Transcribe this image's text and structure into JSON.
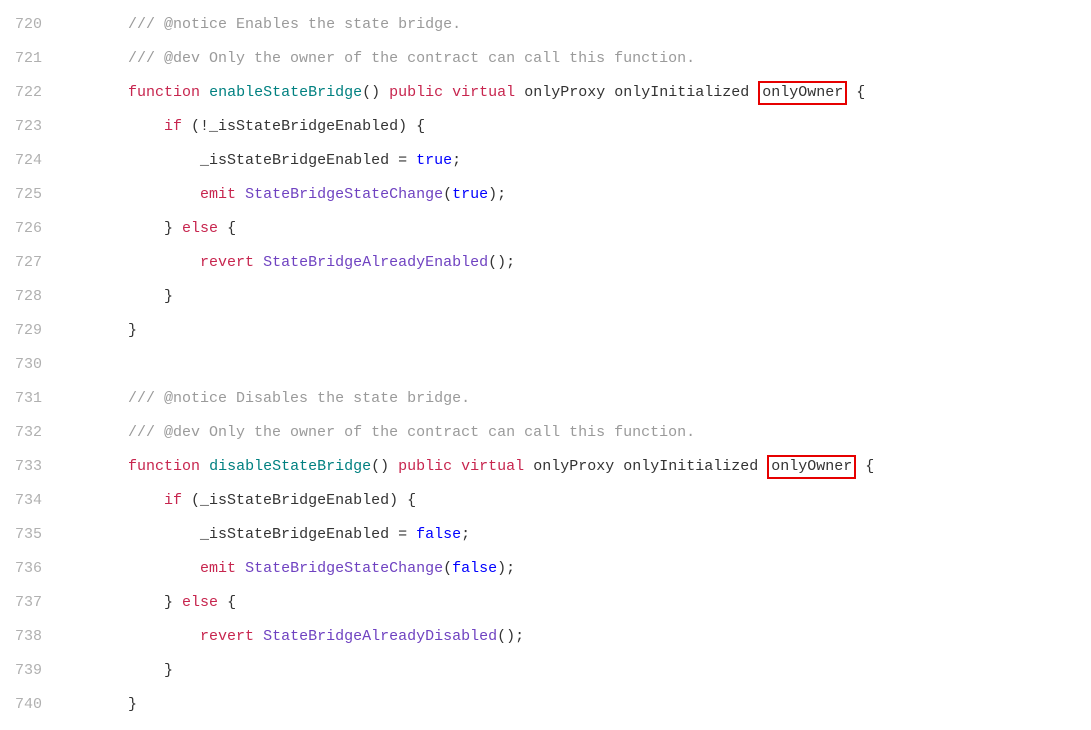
{
  "lineNumbers": [
    "720",
    "721",
    "722",
    "723",
    "724",
    "725",
    "726",
    "727",
    "728",
    "729",
    "730",
    "731",
    "732",
    "733",
    "734",
    "735",
    "736",
    "737",
    "738",
    "739",
    "740"
  ],
  "code": {
    "l720_comment": "/// @notice Enables the state bridge.",
    "l721_comment": "/// @dev Only the owner of the contract can call this function.",
    "l722_function": "function",
    "l722_name": "enableStateBridge",
    "l722_parens": "()",
    "l722_public": "public",
    "l722_virtual": "virtual",
    "l722_mod1": "onlyProxy",
    "l722_mod2": "onlyInitialized",
    "l722_mod3": "onlyOwner",
    "l722_brace": " {",
    "l723_if": "if",
    "l723_cond": " (!_isStateBridgeEnabled) {",
    "l724_assign_lhs": "_isStateBridgeEnabled = ",
    "l724_true": "true",
    "l724_semi": ";",
    "l725_emit": "emit",
    "l725_ev": "StateBridgeStateChange",
    "l725_open": "(",
    "l725_arg": "true",
    "l725_close": ");",
    "l726_close": "} ",
    "l726_else": "else",
    "l726_open": " {",
    "l727_revert": "revert",
    "l727_err": "StateBridgeAlreadyEnabled",
    "l727_close": "();",
    "l728_close": "}",
    "l729_close": "}",
    "l731_comment": "/// @notice Disables the state bridge.",
    "l732_comment": "/// @dev Only the owner of the contract can call this function.",
    "l733_function": "function",
    "l733_name": "disableStateBridge",
    "l733_parens": "()",
    "l733_public": "public",
    "l733_virtual": "virtual",
    "l733_mod1": "onlyProxy",
    "l733_mod2": "onlyInitialized",
    "l733_mod3": "onlyOwner",
    "l733_brace": " {",
    "l734_if": "if",
    "l734_cond": " (_isStateBridgeEnabled) {",
    "l735_assign_lhs": "_isStateBridgeEnabled = ",
    "l735_false": "false",
    "l735_semi": ";",
    "l736_emit": "emit",
    "l736_ev": "StateBridgeStateChange",
    "l736_open": "(",
    "l736_arg": "false",
    "l736_close": ");",
    "l737_close": "} ",
    "l737_else": "else",
    "l737_open": " {",
    "l738_revert": "revert",
    "l738_err": "StateBridgeAlreadyDisabled",
    "l738_close": "();",
    "l739_close": "}",
    "l740_close": "}"
  }
}
